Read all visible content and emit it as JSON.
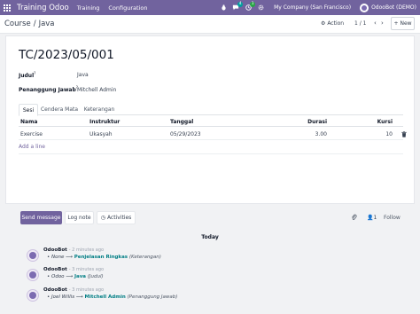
{
  "navbar": {
    "brand": "Training Odoo",
    "menus": [
      "Training",
      "Configuration"
    ],
    "messages_badge": "4",
    "activity_badge": "1",
    "company": "My Company (San Francisco)",
    "user": "OdooBot (DEMO)"
  },
  "control_panel": {
    "breadcrumb_parent": "Course",
    "breadcrumb_separator": "/",
    "breadcrumb_current": "Java",
    "action_label": "Action",
    "pager_value": "1 / 1",
    "new_label": "New"
  },
  "record": {
    "title": "TC/2023/05/001",
    "fields": [
      {
        "label": "Judul",
        "marker": "?",
        "value": "Java"
      },
      {
        "label": "Penanggung Jawab",
        "marker": "?",
        "value": "Mitchell Admin"
      }
    ]
  },
  "tabs": [
    "Sesi",
    "Cendera Mata",
    "Keterangan"
  ],
  "table": {
    "columns": [
      "Nama",
      "Instruktur",
      "Tanggal",
      "Durasi",
      "Kursi"
    ],
    "rows": [
      {
        "nama": "Exercise",
        "instruktur": "Ukasyah",
        "tanggal": "05/29/2023",
        "durasi": "3.00",
        "kursi": "10"
      }
    ],
    "add_line": "Add a line"
  },
  "chatter": {
    "send_message": "Send message",
    "log_note": "Log note",
    "activities": "Activities",
    "followers_count": "1",
    "follow": "Follow",
    "day_label": "Today",
    "messages": [
      {
        "author": "OdooBot",
        "time": "- 2 minutes ago",
        "old": "None",
        "new": "Penjelasan Ringkas",
        "field": "(Keterangan)"
      },
      {
        "author": "OdooBot",
        "time": "- 3 minutes ago",
        "old": "Odoo",
        "new": "Java",
        "field": "(Judul)"
      },
      {
        "author": "OdooBot",
        "time": "- 3 minutes ago",
        "old": "Joel Willis",
        "new": "Mitchell Admin",
        "field": "(Penanggung Jawab)"
      }
    ]
  },
  "colors": {
    "brand": "#71639e",
    "link": "#017e84",
    "messages_badge": "#00a09d",
    "activity_badge": "#28a745"
  },
  "icons": [
    "app-grid-icon",
    "bug-icon",
    "chat-icon",
    "clock-icon",
    "gear-icon",
    "chevron-left-icon",
    "chevron-right-icon",
    "plus-icon",
    "trash-icon",
    "paperclip-icon",
    "person-icon",
    "arrow-icon"
  ]
}
